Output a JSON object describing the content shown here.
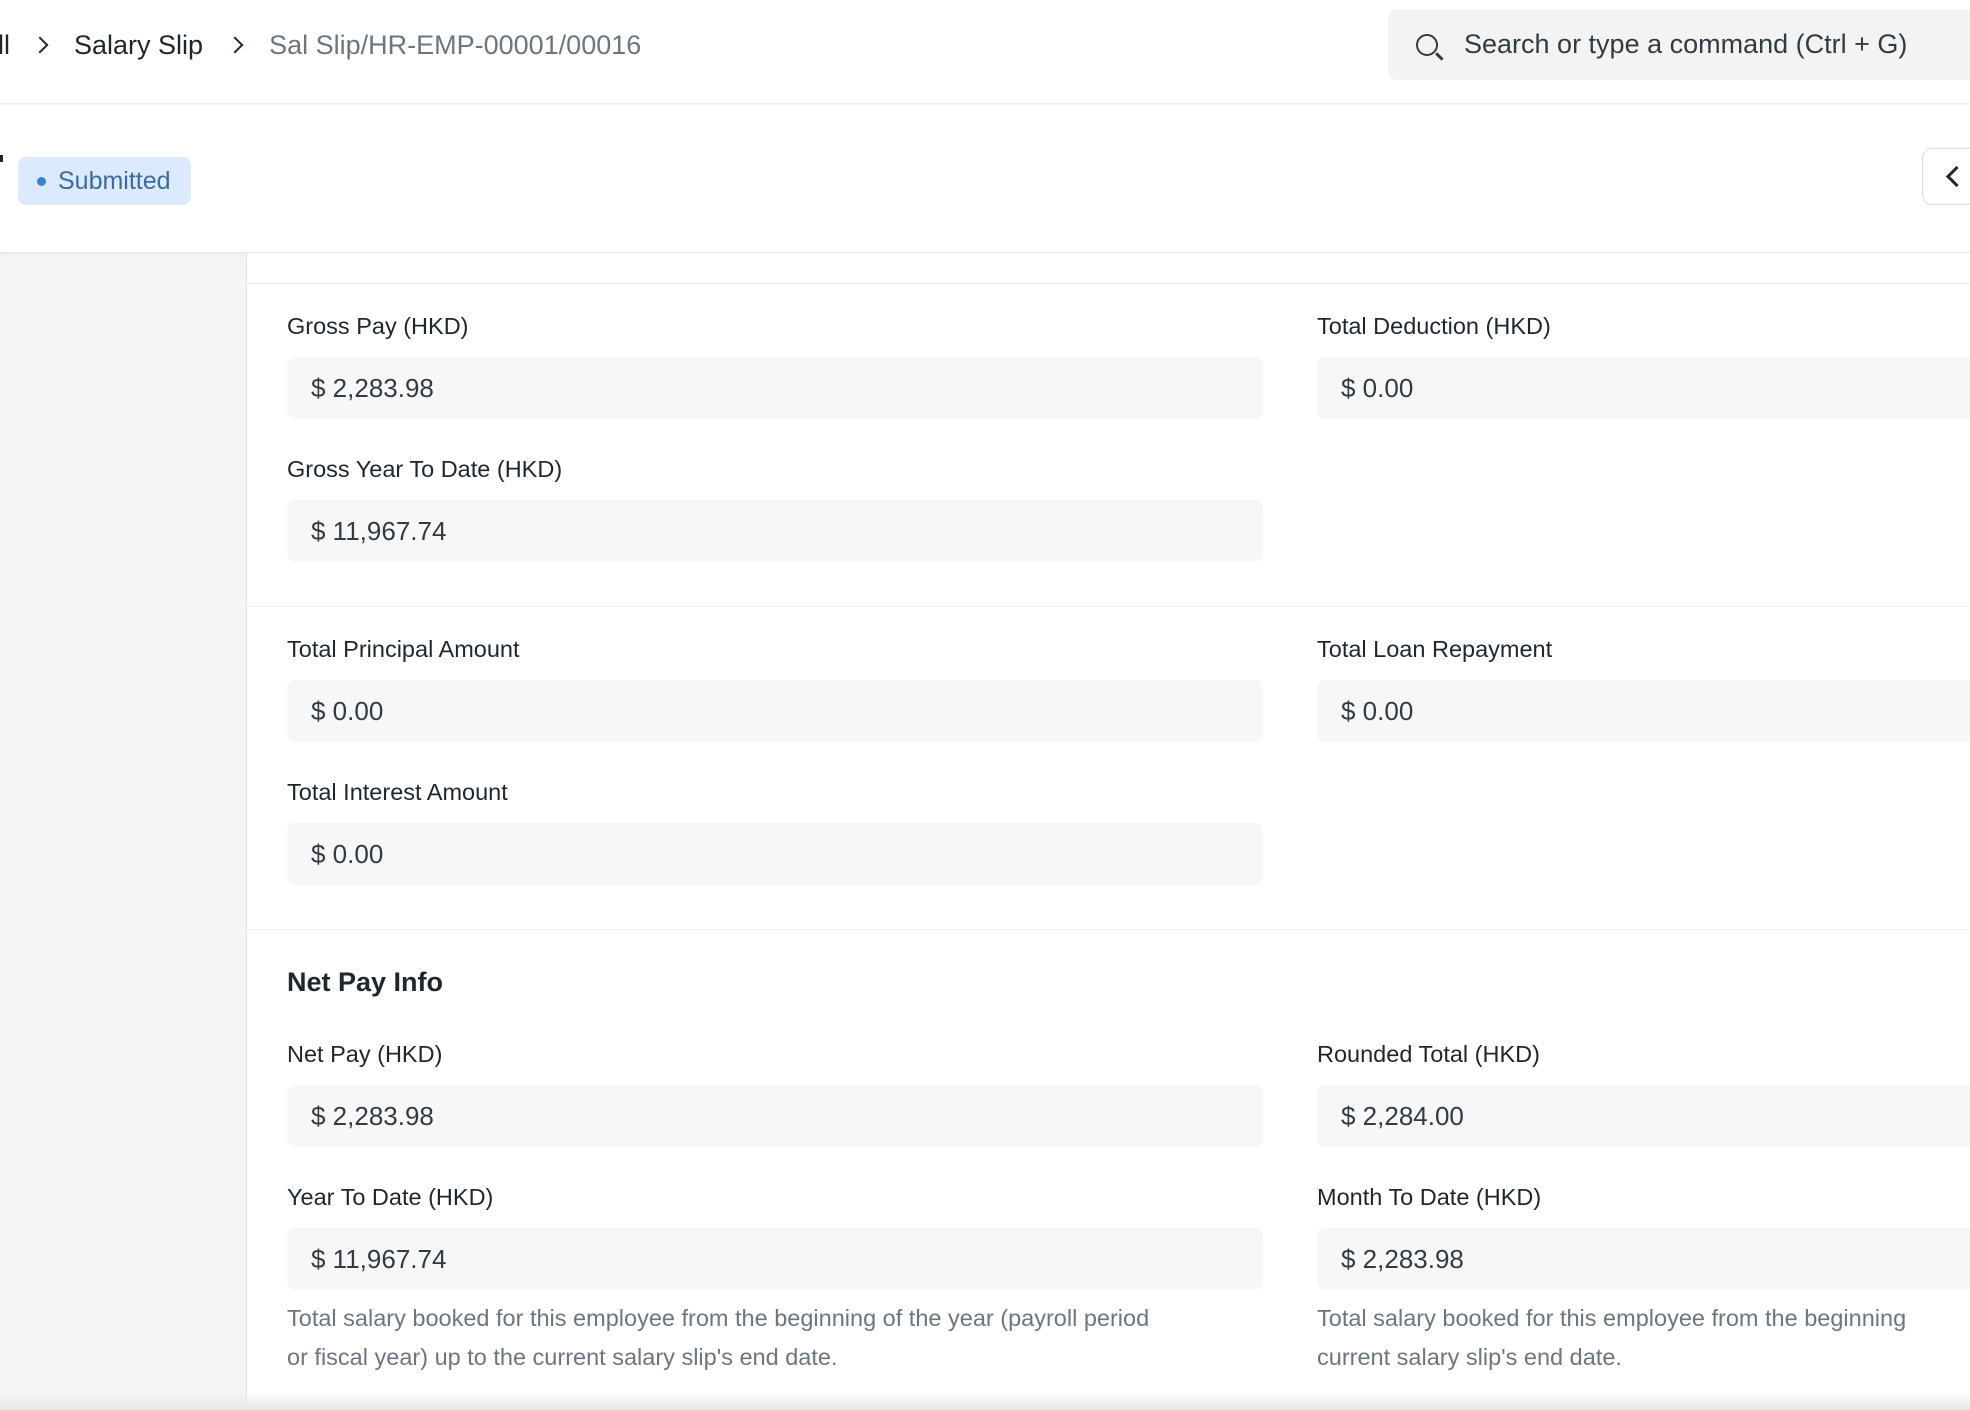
{
  "navbar": {
    "breadcrumb": {
      "partial": "ll",
      "doctype": "Salary Slip",
      "current": "Sal Slip/HR-EMP-00001/00016"
    },
    "search_placeholder": "Search or type a command (Ctrl + G)"
  },
  "page_head": {
    "status": "Submitted"
  },
  "totals_section": {
    "gross_pay_label": "Gross Pay (HKD)",
    "gross_pay_value": "$ 2,283.98",
    "total_deduction_label": "Total Deduction (HKD)",
    "total_deduction_value": "$ 0.00",
    "gross_ytd_label": "Gross Year To Date (HKD)",
    "gross_ytd_value": "$ 11,967.74"
  },
  "loan_section": {
    "total_principal_label": "Total Principal Amount",
    "total_principal_value": "$ 0.00",
    "total_loan_repayment_label": "Total Loan Repayment",
    "total_loan_repayment_value": "$ 0.00",
    "total_interest_label": "Total Interest Amount",
    "total_interest_value": "$ 0.00"
  },
  "net_pay_section": {
    "title": "Net Pay Info",
    "net_pay_label": "Net Pay (HKD)",
    "net_pay_value": "$ 2,283.98",
    "rounded_total_label": "Rounded Total (HKD)",
    "rounded_total_value": "$ 2,284.00",
    "ytd_label": "Year To Date (HKD)",
    "ytd_value": "$ 11,967.74",
    "ytd_description_line1": "Total salary booked for this employee from the beginning of the year (payroll period",
    "ytd_description_line2": "or fiscal year) up to the current salary slip's end date.",
    "mtd_label": "Month To Date (HKD)",
    "mtd_value": "$ 2,283.98",
    "mtd_description_line1": "Total salary booked for this employee from the beginning",
    "mtd_description_line2": "current salary slip's end date."
  }
}
